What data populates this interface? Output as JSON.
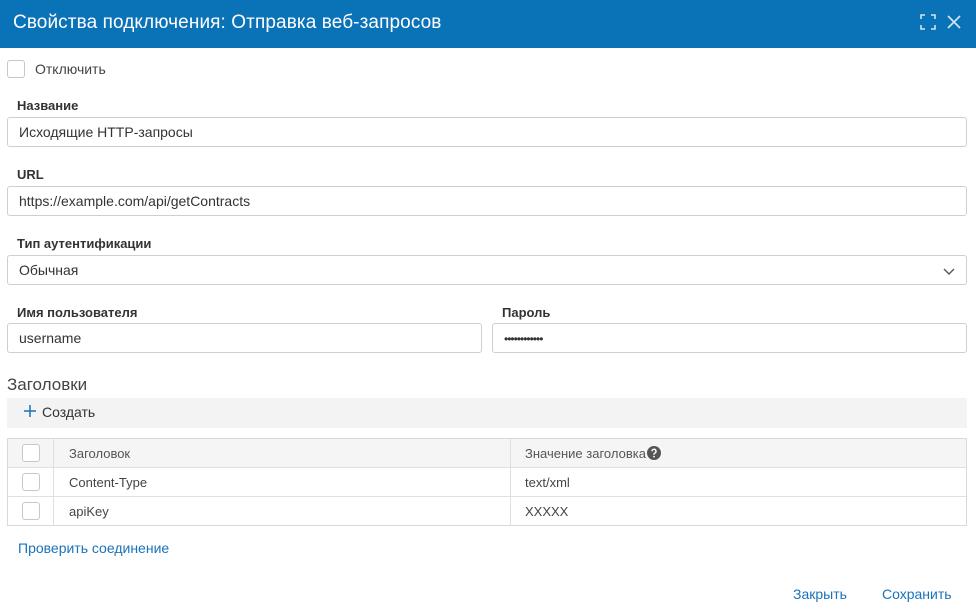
{
  "dialog": {
    "title": "Свойства подключения: Отправка веб-запросов"
  },
  "disable": {
    "label": "Отключить",
    "checked": false
  },
  "fields": {
    "name": {
      "label": "Название",
      "value": "Исходящие HTTP-запросы"
    },
    "url": {
      "label": "URL",
      "value": "https://example.com/api/getContracts"
    },
    "auth_type": {
      "label": "Тип аутентификации",
      "value": "Обычная"
    },
    "username": {
      "label": "Имя пользователя",
      "value": "username"
    },
    "password": {
      "label": "Пароль",
      "value": "••••••••••••"
    }
  },
  "headers_section": {
    "title": "Заголовки",
    "create_label": "Создать",
    "columns": [
      "Заголовок",
      "Значение заголовка"
    ],
    "rows": [
      {
        "name": "Content-Type",
        "value": "text/xml"
      },
      {
        "name": "apiKey",
        "value": "XXXXX"
      }
    ]
  },
  "actions": {
    "test_connection": "Проверить соединение",
    "close": "Закрыть",
    "save": "Сохранить"
  },
  "colors": {
    "titlebar": "#0a73b8",
    "link": "#1a73b8"
  },
  "icons": [
    "maximize-icon",
    "close-icon",
    "chevron-down-icon",
    "plus-icon",
    "help-icon"
  ]
}
